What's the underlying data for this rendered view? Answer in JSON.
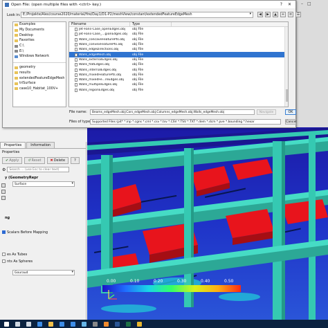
{
  "dialog": {
    "title": "Open File:  (open multiple files with <ctrl> key.)",
    "help_glyph": "?",
    "close_glyph": "✕",
    "look_in_label": "Look in:",
    "look_in_path": "E:/Projekte/Alex/course2020/material/fire/Day1/D1-P2/meshView/constant/extendedFeatureEdgeMesh",
    "nav_icons": [
      "back-icon",
      "forward-icon",
      "up-icon",
      "new-folder-icon",
      "list-view-icon",
      "detail-view-icon"
    ],
    "places": [
      {
        "label": "Examples",
        "kind": "folder"
      },
      {
        "label": "My Documents",
        "kind": "folder"
      },
      {
        "label": "Desktop",
        "kind": "folder"
      },
      {
        "label": "Favorites",
        "kind": "folder"
      },
      {
        "label": "C:\\",
        "kind": "drive"
      },
      {
        "label": "E:\\",
        "kind": "drive"
      },
      {
        "label": "Windows Network",
        "kind": "network"
      }
    ],
    "recent": [
      {
        "label": "geometry"
      },
      {
        "label": "results"
      },
      {
        "label": "extendedFeatureEdgeMesh"
      },
      {
        "label": "triSurface"
      },
      {
        "label": "case10_Habitat_100V+"
      }
    ],
    "columns": {
      "filename": "Filename",
      "type": "Type"
    },
    "files": [
      {
        "name": "Jet-Fans-Case_openEdges.obj",
        "type": "obj File"
      },
      {
        "name": "Jet-Fans-Case_...gionEdges.obj",
        "type": "obj File"
      },
      {
        "name": "Walls_concaveFeaturePts.obj",
        "type": "obj File"
      },
      {
        "name": "Walls_convexFeaturePts.obj",
        "type": "obj File"
      },
      {
        "name": "Walls_edgeDirections.obj",
        "type": "obj File"
      },
      {
        "name": "Walls_edgeMesh.obj",
        "type": "obj File",
        "selected": true
      },
      {
        "name": "Walls_externalEdges.obj",
        "type": "obj File"
      },
      {
        "name": "Walls_flatEdges.obj",
        "type": "obj File"
      },
      {
        "name": "Walls_internalEdges.obj",
        "type": "obj File"
      },
      {
        "name": "Walls_mixedFeaturePts.obj",
        "type": "obj File"
      },
      {
        "name": "Walls_mixedFe...reEdges.obj",
        "type": "obj File"
      },
      {
        "name": "Walls_multipleEdges.obj",
        "type": "obj File"
      },
      {
        "name": "Walls_regionEdges.obj",
        "type": "obj File"
      }
    ],
    "file_name_label": "File name:",
    "file_name_value": "Beams_edgeMesh.obj;Cars_edgeMesh.obj;Columns_edgeMesh.obj;Walls_edgeMesh.obj",
    "navigate_label": "Navigate",
    "ok_label": "OK",
    "files_of_type_label": "Files of type:",
    "files_of_type_value": "Supported Files (pit* *.inp *.cgns *.cml *.csv *.tsv *.CSV *.TSV *.TXT *.dem *.dcm *.pve *.bounding *.hexar",
    "cancel_label": "Cancel"
  },
  "properties_panel": {
    "tabs": [
      "Properties",
      "Information"
    ],
    "title": "Properties",
    "apply_label": "Apply",
    "reset_label": "Reset",
    "delete_label": "Delete",
    "help_glyph": "?",
    "search_placeholder": "Search ... (use Esc to clear text)",
    "section_display": "y (GeometryRepr",
    "representation_value": "Surface",
    "section_coloring": "ng",
    "map_scalars_label": "Scalars Before Mapping",
    "render_tubes_label": "es As Tubes",
    "render_spheres_label": "nts As Spheres",
    "interpolation_value": "Gouraud"
  },
  "viewport": {
    "colorbar_ticks": [
      "0.00",
      "0.10",
      "0.20",
      "0.30",
      "0.40",
      "0.50"
    ],
    "colorbar_stops": [
      "#1b12c8",
      "#1f6dff",
      "#19d7e6",
      "#33ff66",
      "#d8f21a",
      "#ffae12",
      "#ff2a12"
    ],
    "structure_color": "#35c9b2",
    "car_color": "#e8141c",
    "floor_color": "#1f2fc0"
  },
  "taskbar": {
    "icons": [
      "start-icon",
      "search-icon",
      "task-view-icon",
      "edge-icon",
      "explorer-icon",
      "store-icon",
      "mail-icon",
      "paraview-icon",
      "terminal-icon",
      "firefox-icon",
      "word-icon",
      "excel-icon",
      "chrome-icon"
    ],
    "colors": [
      "#ffffff",
      "#cfd8e3",
      "#cfd8e3",
      "#3d8de8",
      "#f2c04a",
      "#3d8de8",
      "#3d8de8",
      "#67b6e8",
      "#888888",
      "#f08a2e",
      "#2b5797",
      "#1e7145",
      "#e8b62e"
    ]
  }
}
